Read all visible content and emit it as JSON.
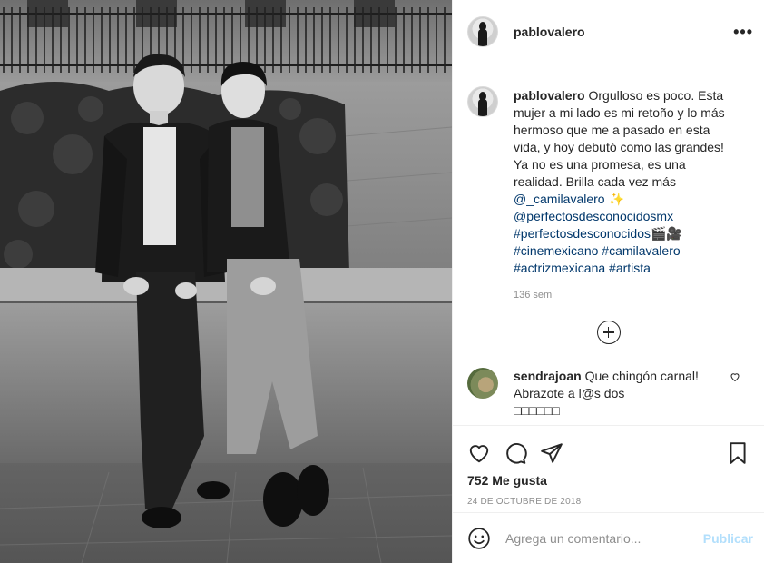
{
  "header": {
    "username": "pablovalero",
    "more_label": "•••"
  },
  "caption": {
    "username": "pablovalero",
    "text": "Orgulloso es poco. Esta mujer a mi lado es mi retoño y lo más hermoso que me a pasado en esta vida, y hoy debutó como las grandes! Ya no es una promesa, es una realidad. Brilla cada vez más",
    "mention": "@_camilavalero",
    "sparkle": "✨",
    "tag1": "@perfectosdesconocidosmx",
    "tag2": "#perfectosdesconocidos",
    "film_emoji": "🎬🎥",
    "tag3": "#cinemexicano",
    "tag4": "#camilavalero",
    "tag5": "#actrizmexicana",
    "tag6": "#artista",
    "time": "136 sem"
  },
  "comment": {
    "username": "sendrajoan",
    "text": "Que chingón carnal! Abrazote a l@s dos",
    "trailing": "□□□□□□"
  },
  "actions": {
    "likes": "752 Me gusta",
    "date": "24 DE OCTUBRE DE 2018"
  },
  "add_comment": {
    "placeholder": "Agrega un comentario...",
    "publish_label": "Publicar"
  },
  "icons": [
    "heart-icon",
    "comment-icon",
    "share-icon",
    "bookmark-icon",
    "emoji-icon",
    "load-more-icon",
    "comment-heart-icon"
  ]
}
